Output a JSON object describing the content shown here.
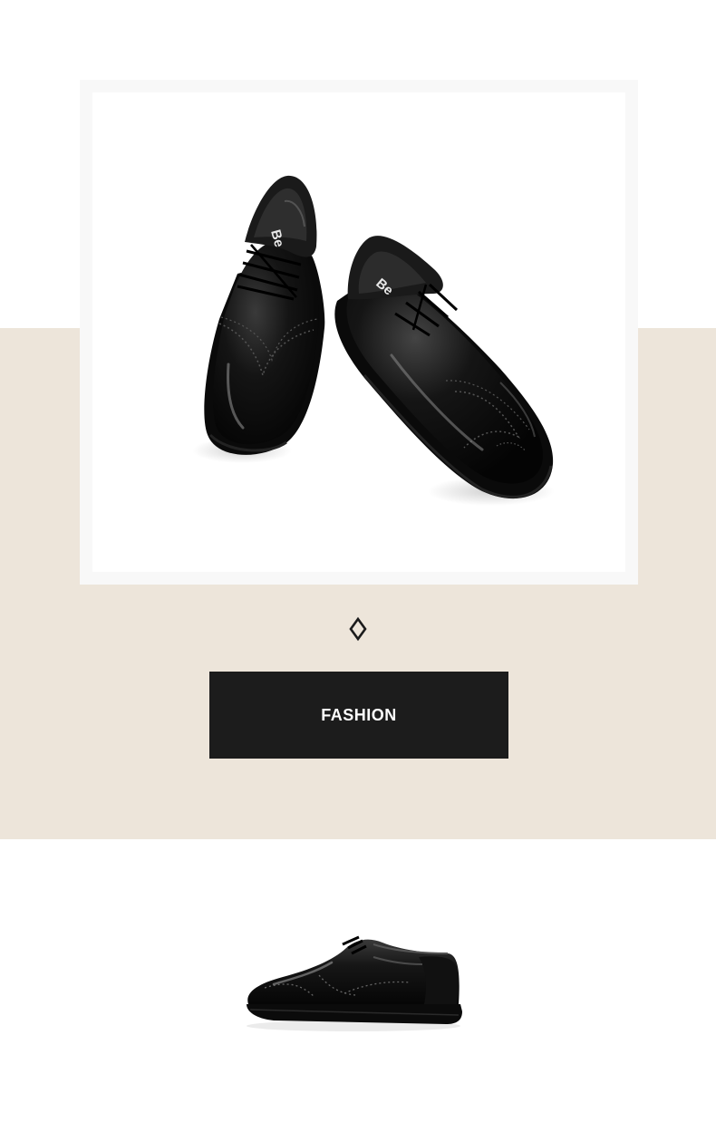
{
  "banner": {
    "label": "FASHION"
  },
  "shoe_brand_mark": "Be",
  "icons": {
    "divider": "diamond-outline-icon"
  },
  "colors": {
    "background": "#ffffff",
    "beige_band": "#ede5da",
    "banner": "#1c1c1c",
    "banner_text": "#ffffff",
    "shoe_leather": "#0d0d0d"
  }
}
